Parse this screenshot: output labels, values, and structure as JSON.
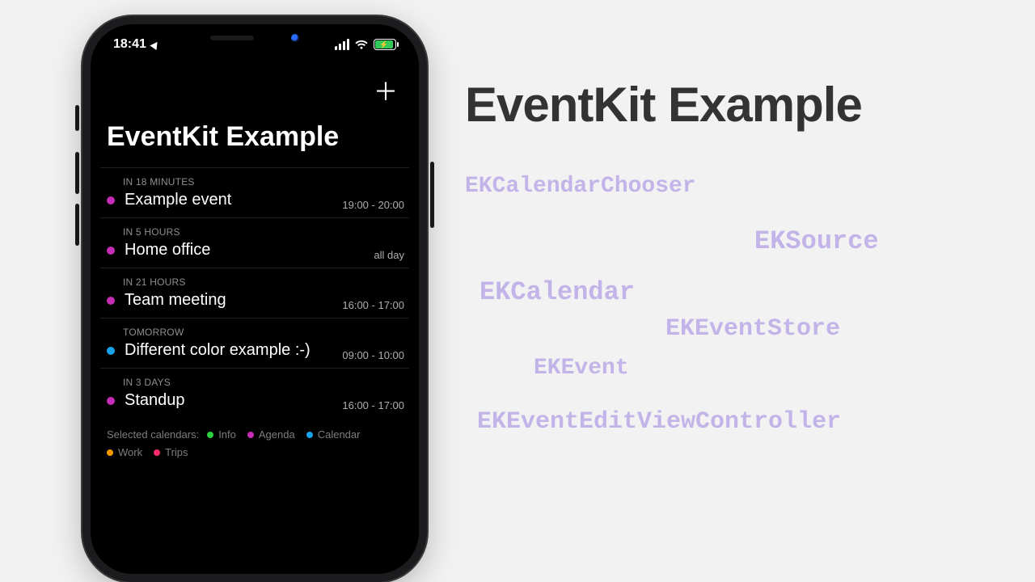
{
  "rhs": {
    "title": "EventKit Example",
    "tags": {
      "chooser": "EKCalendarChooser",
      "source": "EKSource",
      "calendar": "EKCalendar",
      "store": "EKEventStore",
      "event": "EKEvent",
      "editvc": "EKEventEditViewController"
    }
  },
  "phone": {
    "status": {
      "time": "18:41"
    },
    "app_title": "EventKit Example",
    "events": [
      {
        "when": "IN 18 MINUTES",
        "title": "Example event",
        "time": "19:00 - 20:00",
        "color": "#c62db6"
      },
      {
        "when": "IN 5 HOURS",
        "title": "Home office",
        "time": "all day",
        "color": "#c62db6"
      },
      {
        "when": "IN 21 HOURS",
        "title": "Team meeting",
        "time": "16:00 - 17:00",
        "color": "#c62db6"
      },
      {
        "when": "TOMORROW",
        "title": "Different color example :-)",
        "time": "09:00 - 10:00",
        "color": "#17a3ea"
      },
      {
        "when": "IN 3 DAYS",
        "title": "Standup",
        "time": "16:00 - 17:00",
        "color": "#c62db6"
      }
    ],
    "footer": {
      "label": "Selected calendars:",
      "calendars": [
        {
          "name": "Info",
          "color": "#2bcf3f"
        },
        {
          "name": "Agenda",
          "color": "#c62db6"
        },
        {
          "name": "Calendar",
          "color": "#17a3ea"
        },
        {
          "name": "Work",
          "color": "#ff9500"
        },
        {
          "name": "Trips",
          "color": "#ff2d6b"
        }
      ]
    }
  }
}
